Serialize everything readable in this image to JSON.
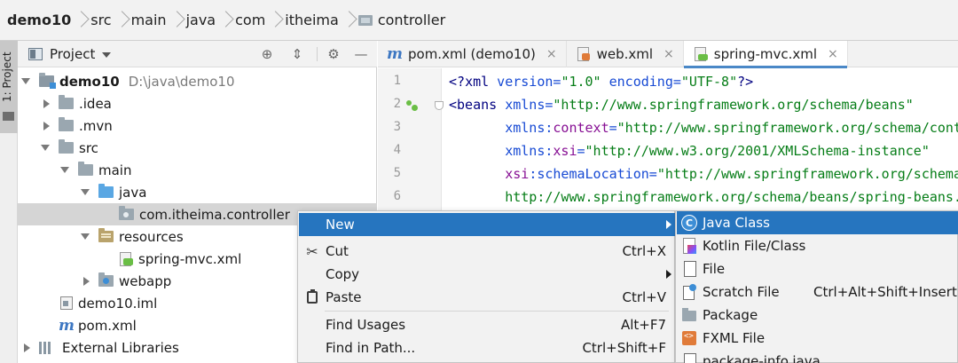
{
  "breadcrumb": [
    "demo10",
    "src",
    "main",
    "java",
    "com",
    "itheima",
    "controller"
  ],
  "tool_stripe": {
    "label": "1: Project"
  },
  "project_panel": {
    "title": "Project",
    "tree": [
      {
        "label": "demo10",
        "hint": "D:\\java\\demo10"
      },
      {
        "label": ".idea"
      },
      {
        "label": ".mvn"
      },
      {
        "label": "src"
      },
      {
        "label": "main"
      },
      {
        "label": "java"
      },
      {
        "label": "com.itheima.controller"
      },
      {
        "label": "resources"
      },
      {
        "label": "spring-mvc.xml"
      },
      {
        "label": "webapp"
      },
      {
        "label": "demo10.iml"
      },
      {
        "label": "pom.xml"
      },
      {
        "label": "External Libraries"
      }
    ]
  },
  "editor": {
    "tabs": [
      {
        "label": "pom.xml (demo10)",
        "close": "×"
      },
      {
        "label": "web.xml",
        "close": "×"
      },
      {
        "label": "spring-mvc.xml",
        "close": "×",
        "active": true
      }
    ],
    "line_numbers": [
      "1",
      "2",
      "3",
      "4",
      "5",
      "6"
    ],
    "code": {
      "l1": {
        "a": "<?",
        "b": "xml",
        "c": " version=",
        "d": "\"1.0\"",
        "e": " encoding=",
        "f": "\"UTF-8\"",
        "g": "?>"
      },
      "l2": {
        "a": "<",
        "b": "beans",
        "c": " xmlns=",
        "d": "\"http://www.springframework.org/schema/beans\""
      },
      "l3": {
        "a": "       ",
        "b": "xmlns:",
        "c": "context",
        "d": "=",
        "e": "\"http://www.springframework.org/schema/context\""
      },
      "l4": {
        "a": "       ",
        "b": "xmlns:",
        "c": "xsi",
        "d": "=",
        "e": "\"http://www.w3.org/2001/XMLSchema-instance\""
      },
      "l5": {
        "a": "       ",
        "b": "xsi",
        "c": ":schemaLocation=",
        "d": "\"http://www.springframework.org/schema/beans"
      },
      "l6": {
        "a": "       ",
        "b": "http://www.springframework.org/schema/beans/spring-beans.xsd"
      }
    }
  },
  "context_menu": {
    "items": [
      {
        "label": "New",
        "shortcut": "",
        "submenu": true
      },
      {
        "label": "Cut",
        "shortcut": "Ctrl+X"
      },
      {
        "label": "Copy",
        "shortcut": "",
        "submenu": true
      },
      {
        "label": "Paste",
        "shortcut": "Ctrl+V"
      },
      {
        "label": "Find Usages",
        "shortcut": "Alt+F7"
      },
      {
        "label": "Find in Path...",
        "shortcut": "Ctrl+Shift+F"
      }
    ]
  },
  "submenu": {
    "items": [
      {
        "label": "Java Class",
        "shortcut": ""
      },
      {
        "label": "Kotlin File/Class",
        "shortcut": ""
      },
      {
        "label": "File",
        "shortcut": ""
      },
      {
        "label": "Scratch File",
        "shortcut": "Ctrl+Alt+Shift+Insert"
      },
      {
        "label": "Package",
        "shortcut": ""
      },
      {
        "label": "FXML File",
        "shortcut": ""
      },
      {
        "label": "package-info.java",
        "shortcut": ""
      }
    ]
  },
  "colors": {
    "selection": "#2675bf",
    "tab_underline": "#4a88c7",
    "tree_selected": "#d5d5d5",
    "xml_tag": "#000080",
    "xml_attr": "#174ad4",
    "xml_value": "#067d17"
  },
  "icons": {
    "crumb_folder": "folder-icon",
    "locate": "crosshair-icon",
    "collapse": "collapse-all-icon",
    "settings": "gear-icon",
    "hide": "minimize-icon"
  }
}
